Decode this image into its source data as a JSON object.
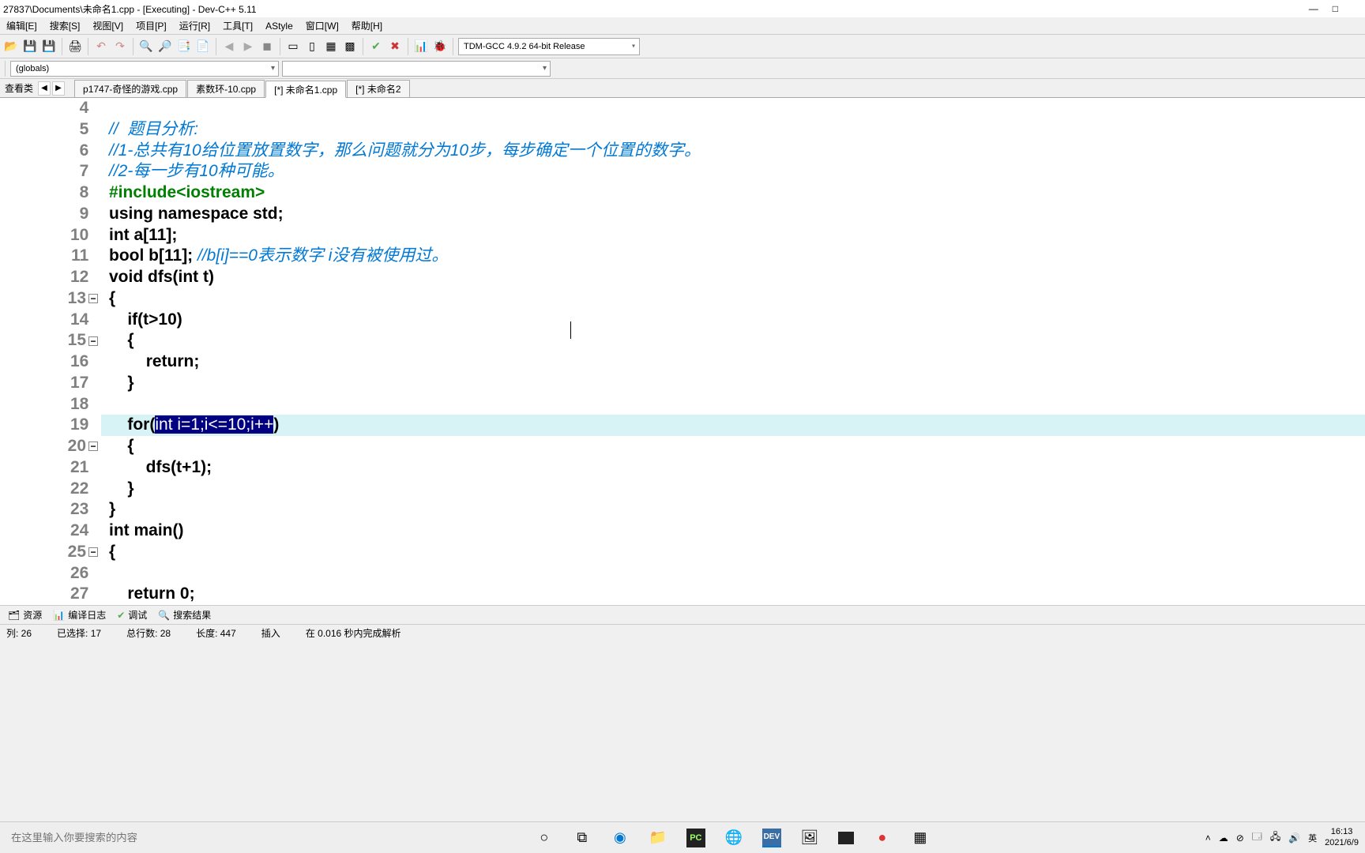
{
  "title_bar": {
    "path": "27837\\Documents\\未命名1.cpp - [Executing] - Dev-C++ 5.11",
    "min": "—",
    "max": "□"
  },
  "menu": {
    "edit": "编辑[E]",
    "search": "搜索[S]",
    "view": "视图[V]",
    "project": "项目[P]",
    "run": "运行[R]",
    "tools": "工具[T]",
    "astyle": "AStyle",
    "window": "窗口[W]",
    "help": "帮助[H]"
  },
  "toolbar": {
    "compiler": "TDM-GCC 4.9.2 64-bit Release"
  },
  "toolbar2": {
    "globals": "(globals)"
  },
  "tabs": {
    "left_label": "查看类",
    "prev": "◀",
    "next": "▶",
    "t1": "p1747-奇怪的游戏.cpp",
    "t2": "素数环-10.cpp",
    "t3": "[*] 未命名1.cpp",
    "t4": "[*] 未命名2"
  },
  "gutter": [
    "4",
    "5",
    "6",
    "7",
    "8",
    "9",
    "10",
    "11",
    "12",
    "13",
    "14",
    "15",
    "16",
    "17",
    "18",
    "19",
    "20",
    "21",
    "22",
    "23",
    "24",
    "25",
    "26",
    "27"
  ],
  "code": {
    "l4": "",
    "l5": "//  题目分析:",
    "l6": "//1-总共有10给位置放置数字，那么问题就分为10步，每步确定一个位置的数字。",
    "l7": "//2-每一步有10种可能。",
    "l8a": "#include",
    "l8b": "<iostream>",
    "l9a": "using",
    "l9b": " ",
    "l9c": "namespace",
    "l9d": " std;",
    "l10a": "int",
    "l10b": " a[",
    "l10c": "11",
    "l10d": "];",
    "l11a": "bool",
    "l11b": " b[",
    "l11c": "11",
    "l11d": "]; ",
    "l11e": "//b[i]==0表示数字 i没有被使用过。",
    "l12a": "void",
    "l12b": " dfs(",
    "l12c": "int",
    "l12d": " t)",
    "l13": "{",
    "l14a": "    if",
    "l14b": "(t>",
    "l14c": "10",
    "l14d": ")",
    "l15": "    {",
    "l16a": "        ",
    "l16b": "return",
    "l16c": ";",
    "l17": "    }",
    "l18": "",
    "l19a": "    ",
    "l19b": "for",
    "l19c": "(",
    "l19sel": "int i=1;i<=10;i++",
    "l19d": ")",
    "l20": "    {",
    "l21a": "        dfs(t+",
    "l21b": "1",
    "l21c": ");",
    "l22": "    }",
    "l23": "}",
    "l24a": "int",
    "l24b": " main()",
    "l25": "{",
    "l26": "",
    "l27a": "    ",
    "l27b": "return",
    "l27c": " ",
    "l27d": "0",
    "l27e": ";"
  },
  "bottom_tabs": {
    "res": "资源",
    "log": "编译日志",
    "dbg": "调试",
    "sr": "搜索结果"
  },
  "status": {
    "col": "列:   26",
    "sel": "已选择:   17",
    "lines": "总行数:   28",
    "len": "长度:  447",
    "mode": "插入",
    "parse": "在 0.016 秒内完成解析"
  },
  "taskbar": {
    "search_ph": "在这里输入你要搜索的内容",
    "time": "16:13",
    "date": "2021/6/9",
    "ime": "英"
  }
}
